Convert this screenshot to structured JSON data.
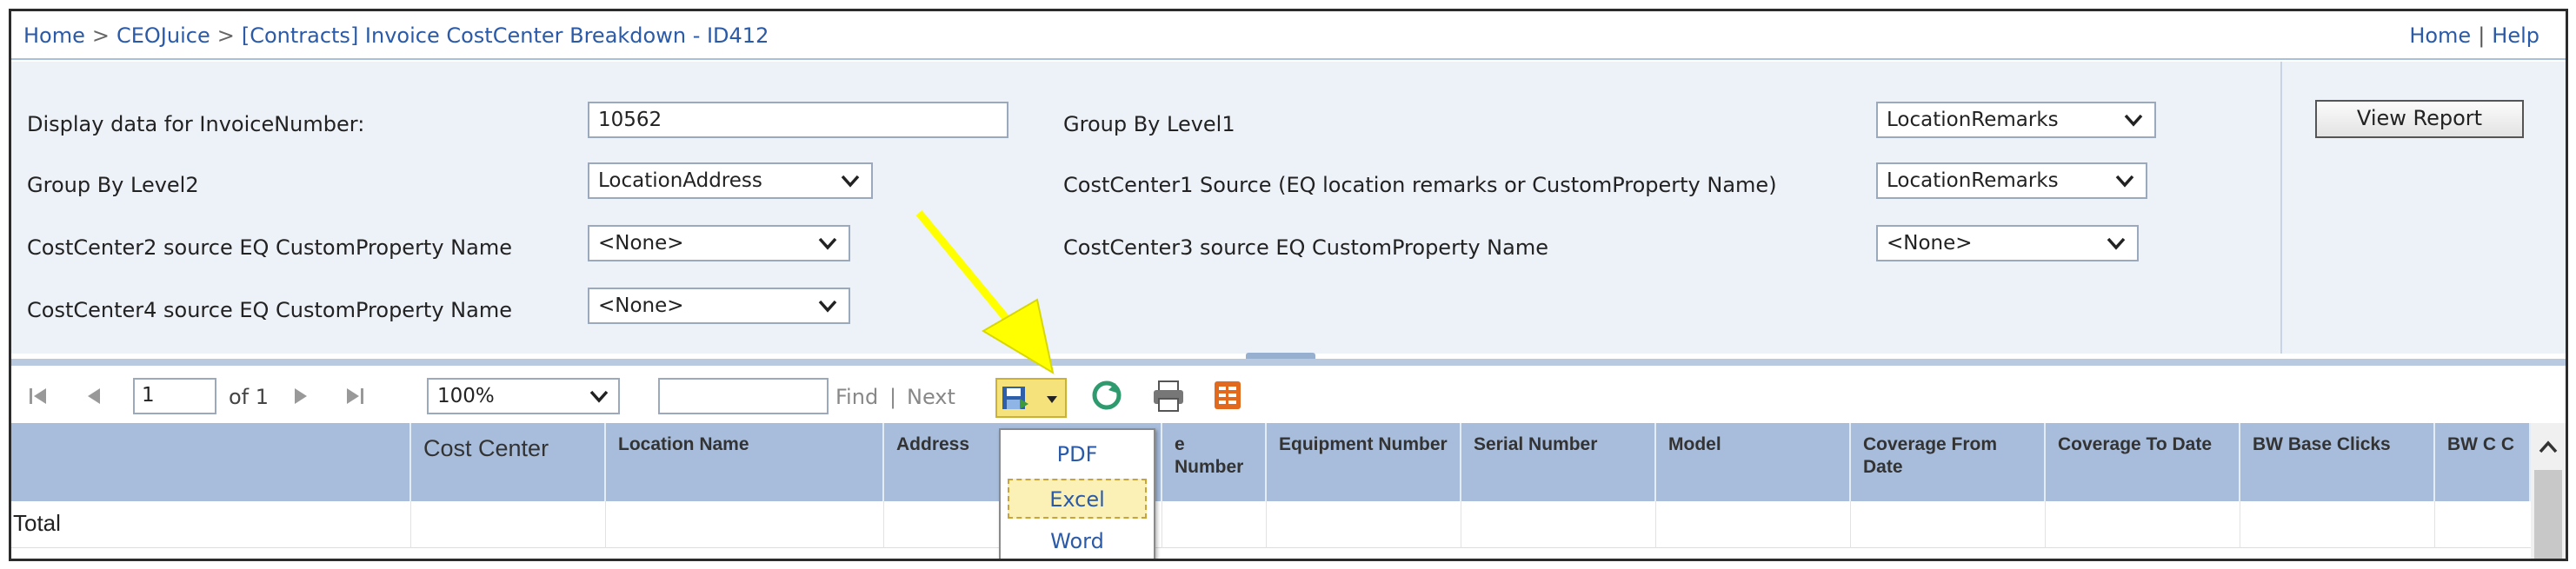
{
  "breadcrumb": {
    "items": [
      "Home",
      "CEOJuice",
      "[Contracts] Invoice CostCenter Breakdown - ID412"
    ],
    "separator": ">"
  },
  "top_links": {
    "home": "Home",
    "separator": "|",
    "help": "Help"
  },
  "params": {
    "invoice_label": "Display data for InvoiceNumber:",
    "invoice_value": "10562",
    "group1_label": "Group By Level1",
    "group1_value": "LocationRemarks",
    "group2_label": "Group By Level2",
    "group2_value": "LocationAddress",
    "cc1_label": "CostCenter1 Source (EQ location remarks or CustomProperty Name)",
    "cc1_value": "LocationRemarks",
    "cc2_label": "CostCenter2 source EQ CustomProperty Name",
    "cc2_value": "<None>",
    "cc3_label": "CostCenter3 source EQ CustomProperty Name",
    "cc3_value": "<None>",
    "cc4_label": "CostCenter4 source EQ CustomProperty Name",
    "cc4_value": "<None>",
    "view_report": "View Report"
  },
  "toolbar": {
    "page_value": "1",
    "of_pages": "of 1",
    "zoom": "100%",
    "find_value": "",
    "find": "Find",
    "find_sep": "|",
    "next": "Next"
  },
  "export_menu": {
    "items": [
      "PDF",
      "Excel",
      "Word"
    ],
    "highlighted": "Excel"
  },
  "grid": {
    "headers": [
      "",
      "Cost Center",
      "Location Name",
      "Address",
      "e Number",
      "Equipment Number",
      "Serial Number",
      "Model",
      "Coverage From Date",
      "Coverage To Date",
      "BW Base Clicks",
      "BW C C"
    ],
    "total_label": "Total"
  },
  "colors": {
    "link": "#2a5aa8",
    "param_bg": "#edf1f8",
    "grid_header": "#a7bddb",
    "highlight": "#fbf1b7",
    "arrow": "#ffff00"
  }
}
